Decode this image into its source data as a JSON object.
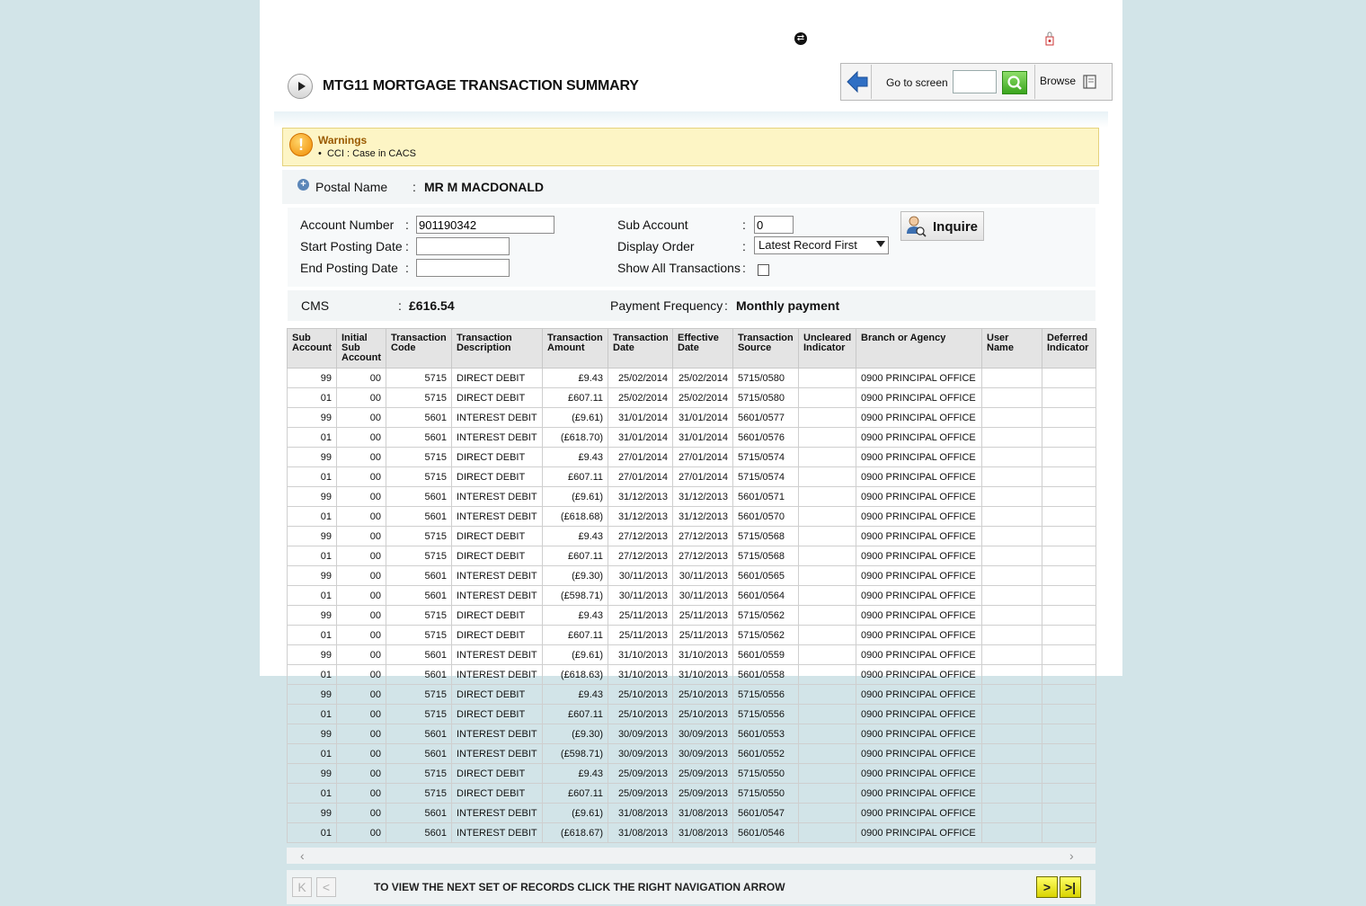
{
  "header": {
    "title": "MTG11 MORTGAGE TRANSACTION SUMMARY",
    "goto_label": "Go to screen",
    "goto_value": "",
    "browse_label": "Browse"
  },
  "warnings": {
    "title": "Warnings",
    "items": [
      "CCI : Case in CACS"
    ]
  },
  "postal": {
    "label": "Postal Name",
    "colon": ":",
    "value": "MR M MACDONALD"
  },
  "form": {
    "account_number_label": "Account Number",
    "account_number_value": "901190342",
    "start_date_label": "Start Posting Date",
    "start_date_value": "",
    "end_date_label": "End Posting Date",
    "end_date_value": "",
    "sub_account_label": "Sub Account",
    "sub_account_value": "0",
    "display_order_label": "Display Order",
    "display_order_value": "Latest Record First",
    "show_all_label": "Show All Transactions",
    "show_all_checked": false,
    "colon": ":",
    "inquire_label": "Inquire"
  },
  "summary": {
    "cms_label": "CMS",
    "cms_value": "£616.54",
    "payment_frequency_label": "Payment Frequency",
    "payment_frequency_value": "Monthly payment",
    "colon": ":"
  },
  "table": {
    "headers": [
      "Sub Account",
      "Initial Sub Account",
      "Transaction Code",
      "Transaction Description",
      "Transaction Amount",
      "Transaction Date",
      "Effective Date",
      "Transaction Source",
      "Uncleared Indicator",
      "Branch or Agency",
      "User Name",
      "Deferred Indicator"
    ],
    "rows": [
      [
        "99",
        "00",
        "5715",
        "DIRECT DEBIT",
        "£9.43",
        "25/02/2014",
        "25/02/2014",
        "5715/0580",
        "",
        "0900 PRINCIPAL OFFICE",
        "",
        ""
      ],
      [
        "01",
        "00",
        "5715",
        "DIRECT DEBIT",
        "£607.11",
        "25/02/2014",
        "25/02/2014",
        "5715/0580",
        "",
        "0900 PRINCIPAL OFFICE",
        "",
        ""
      ],
      [
        "99",
        "00",
        "5601",
        "INTEREST DEBIT",
        "(£9.61)",
        "31/01/2014",
        "31/01/2014",
        "5601/0577",
        "",
        "0900 PRINCIPAL OFFICE",
        "",
        ""
      ],
      [
        "01",
        "00",
        "5601",
        "INTEREST DEBIT",
        "(£618.70)",
        "31/01/2014",
        "31/01/2014",
        "5601/0576",
        "",
        "0900 PRINCIPAL OFFICE",
        "",
        ""
      ],
      [
        "99",
        "00",
        "5715",
        "DIRECT DEBIT",
        "£9.43",
        "27/01/2014",
        "27/01/2014",
        "5715/0574",
        "",
        "0900 PRINCIPAL OFFICE",
        "",
        ""
      ],
      [
        "01",
        "00",
        "5715",
        "DIRECT DEBIT",
        "£607.11",
        "27/01/2014",
        "27/01/2014",
        "5715/0574",
        "",
        "0900 PRINCIPAL OFFICE",
        "",
        ""
      ],
      [
        "99",
        "00",
        "5601",
        "INTEREST DEBIT",
        "(£9.61)",
        "31/12/2013",
        "31/12/2013",
        "5601/0571",
        "",
        "0900 PRINCIPAL OFFICE",
        "",
        ""
      ],
      [
        "01",
        "00",
        "5601",
        "INTEREST DEBIT",
        "(£618.68)",
        "31/12/2013",
        "31/12/2013",
        "5601/0570",
        "",
        "0900 PRINCIPAL OFFICE",
        "",
        ""
      ],
      [
        "99",
        "00",
        "5715",
        "DIRECT DEBIT",
        "£9.43",
        "27/12/2013",
        "27/12/2013",
        "5715/0568",
        "",
        "0900 PRINCIPAL OFFICE",
        "",
        ""
      ],
      [
        "01",
        "00",
        "5715",
        "DIRECT DEBIT",
        "£607.11",
        "27/12/2013",
        "27/12/2013",
        "5715/0568",
        "",
        "0900 PRINCIPAL OFFICE",
        "",
        ""
      ],
      [
        "99",
        "00",
        "5601",
        "INTEREST DEBIT",
        "(£9.30)",
        "30/11/2013",
        "30/11/2013",
        "5601/0565",
        "",
        "0900 PRINCIPAL OFFICE",
        "",
        ""
      ],
      [
        "01",
        "00",
        "5601",
        "INTEREST DEBIT",
        "(£598.71)",
        "30/11/2013",
        "30/11/2013",
        "5601/0564",
        "",
        "0900 PRINCIPAL OFFICE",
        "",
        ""
      ],
      [
        "99",
        "00",
        "5715",
        "DIRECT DEBIT",
        "£9.43",
        "25/11/2013",
        "25/11/2013",
        "5715/0562",
        "",
        "0900 PRINCIPAL OFFICE",
        "",
        ""
      ],
      [
        "01",
        "00",
        "5715",
        "DIRECT DEBIT",
        "£607.11",
        "25/11/2013",
        "25/11/2013",
        "5715/0562",
        "",
        "0900 PRINCIPAL OFFICE",
        "",
        ""
      ],
      [
        "99",
        "00",
        "5601",
        "INTEREST DEBIT",
        "(£9.61)",
        "31/10/2013",
        "31/10/2013",
        "5601/0559",
        "",
        "0900 PRINCIPAL OFFICE",
        "",
        ""
      ],
      [
        "01",
        "00",
        "5601",
        "INTEREST DEBIT",
        "(£618.63)",
        "31/10/2013",
        "31/10/2013",
        "5601/0558",
        "",
        "0900 PRINCIPAL OFFICE",
        "",
        ""
      ],
      [
        "99",
        "00",
        "5715",
        "DIRECT DEBIT",
        "£9.43",
        "25/10/2013",
        "25/10/2013",
        "5715/0556",
        "",
        "0900 PRINCIPAL OFFICE",
        "",
        ""
      ],
      [
        "01",
        "00",
        "5715",
        "DIRECT DEBIT",
        "£607.11",
        "25/10/2013",
        "25/10/2013",
        "5715/0556",
        "",
        "0900 PRINCIPAL OFFICE",
        "",
        ""
      ],
      [
        "99",
        "00",
        "5601",
        "INTEREST DEBIT",
        "(£9.30)",
        "30/09/2013",
        "30/09/2013",
        "5601/0553",
        "",
        "0900 PRINCIPAL OFFICE",
        "",
        ""
      ],
      [
        "01",
        "00",
        "5601",
        "INTEREST DEBIT",
        "(£598.71)",
        "30/09/2013",
        "30/09/2013",
        "5601/0552",
        "",
        "0900 PRINCIPAL OFFICE",
        "",
        ""
      ],
      [
        "99",
        "00",
        "5715",
        "DIRECT DEBIT",
        "£9.43",
        "25/09/2013",
        "25/09/2013",
        "5715/0550",
        "",
        "0900 PRINCIPAL OFFICE",
        "",
        ""
      ],
      [
        "01",
        "00",
        "5715",
        "DIRECT DEBIT",
        "£607.11",
        "25/09/2013",
        "25/09/2013",
        "5715/0550",
        "",
        "0900 PRINCIPAL OFFICE",
        "",
        ""
      ],
      [
        "99",
        "00",
        "5601",
        "INTEREST DEBIT",
        "(£9.61)",
        "31/08/2013",
        "31/08/2013",
        "5601/0547",
        "",
        "0900 PRINCIPAL OFFICE",
        "",
        ""
      ],
      [
        "01",
        "00",
        "5601",
        "INTEREST DEBIT",
        "(£618.67)",
        "31/08/2013",
        "31/08/2013",
        "5601/0546",
        "",
        "0900 PRINCIPAL OFFICE",
        "",
        ""
      ]
    ]
  },
  "pager": {
    "message": "TO VIEW THE NEXT SET OF RECORDS CLICK THE RIGHT NAVIGATION ARROW",
    "first_glyph": "K",
    "prev_glyph": "<",
    "next_glyph": ">",
    "last_glyph": ">|"
  },
  "icons": {
    "back": "back-arrow-icon",
    "search": "search-icon",
    "browse": "book-icon",
    "warning": "warning-icon",
    "expand": "expand-plus-icon",
    "inquire": "user-search-icon"
  },
  "colors": {
    "background": "#d2e4e8",
    "warning_bg": "#fdf5c5",
    "warning_text": "#9a5a00",
    "pager_active": "#d9d300"
  }
}
